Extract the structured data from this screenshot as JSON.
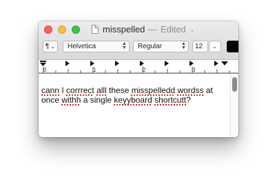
{
  "window": {
    "title": "misspelled",
    "separator": "—",
    "edited": "Edited",
    "title_menu_chevron": "chevron-down-icon"
  },
  "toolbar": {
    "paragraph_symbol": "¶",
    "font_family": "Helvetica",
    "font_style": "Regular",
    "font_size": "12",
    "text_color": "#000000"
  },
  "ruler": {
    "labels": [
      "0",
      "1",
      "2",
      "3"
    ]
  },
  "document": {
    "lines": [
      [
        {
          "t": "cann",
          "e": true
        },
        {
          "t": " I ",
          "e": false
        },
        {
          "t": "corrrect",
          "e": true
        },
        {
          "t": " ",
          "e": false
        },
        {
          "t": "alll",
          "e": true
        },
        {
          "t": " these ",
          "e": false
        },
        {
          "t": "misspelledd",
          "e": true
        },
        {
          "t": " ",
          "e": false
        },
        {
          "t": "wordss",
          "e": true
        },
        {
          "t": " at",
          "e": false
        }
      ],
      [
        {
          "t": "once ",
          "e": false
        },
        {
          "t": "withh",
          "e": true
        },
        {
          "t": " a single ",
          "e": false
        },
        {
          "t": "keyyboard",
          "e": true
        },
        {
          "t": " ",
          "e": false
        },
        {
          "t": "shortcutt",
          "e": true
        },
        {
          "t": "?",
          "e": false
        }
      ]
    ]
  },
  "colors": {
    "close": "#fc605b",
    "minimize": "#fdbc40",
    "zoom": "#34c84a",
    "spelling_underline": "#e0201a"
  }
}
